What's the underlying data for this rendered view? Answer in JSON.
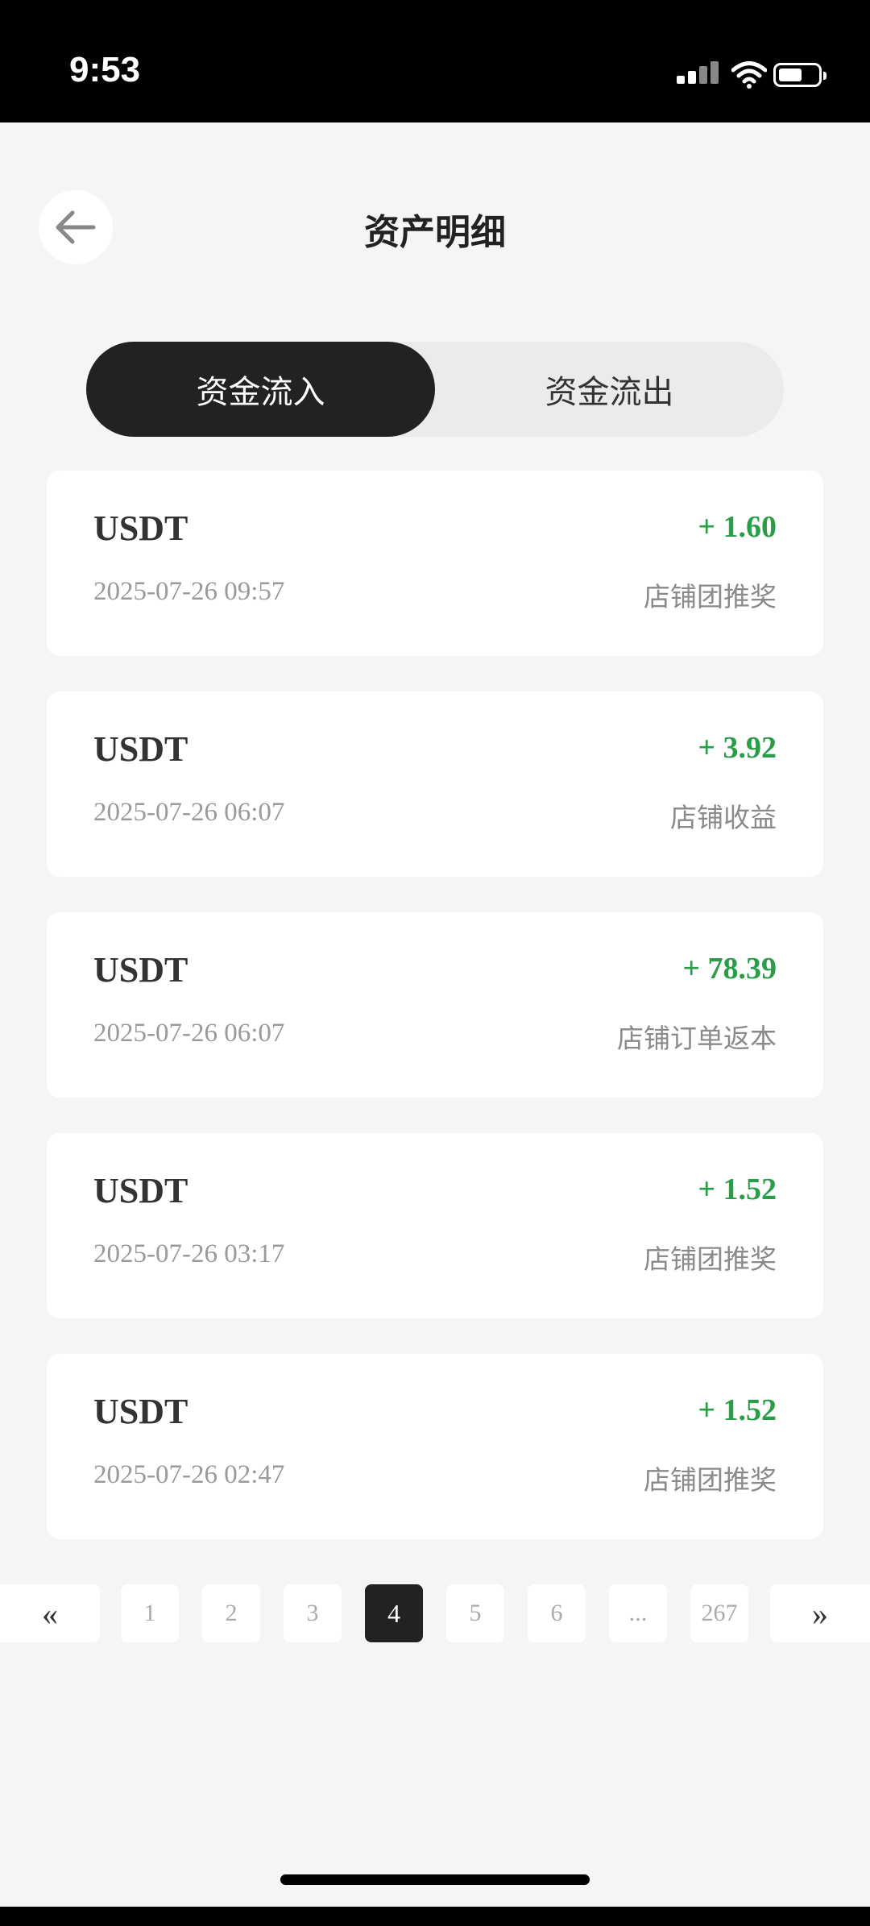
{
  "status_bar": {
    "time": "9:53",
    "icons": [
      "signal-icon",
      "wifi-icon",
      "battery-icon"
    ]
  },
  "header": {
    "title": "资产明细",
    "back_icon": "arrow-left-icon"
  },
  "tabs": [
    {
      "label": "资金流入",
      "active": true
    },
    {
      "label": "资金流出",
      "active": false
    }
  ],
  "records": [
    {
      "currency": "USDT",
      "amount": "+ 1.60",
      "time": "2025-07-26 09:57",
      "type": "店铺团推奖"
    },
    {
      "currency": "USDT",
      "amount": "+ 3.92",
      "time": "2025-07-26 06:07",
      "type": "店铺收益"
    },
    {
      "currency": "USDT",
      "amount": "+ 78.39",
      "time": "2025-07-26 06:07",
      "type": "店铺订单返本"
    },
    {
      "currency": "USDT",
      "amount": "+ 1.52",
      "time": "2025-07-26 03:17",
      "type": "店铺团推奖"
    },
    {
      "currency": "USDT",
      "amount": "+ 1.52",
      "time": "2025-07-26 02:47",
      "type": "店铺团推奖"
    }
  ],
  "pagination": {
    "prev": "«",
    "next": "»",
    "pages": [
      "1",
      "2",
      "3",
      "4",
      "5",
      "6",
      "...",
      "267"
    ],
    "current": "4"
  },
  "colors": {
    "positive_amount": "#2a9d48",
    "active_tab": "#222222",
    "background": "#f5f5f5"
  }
}
